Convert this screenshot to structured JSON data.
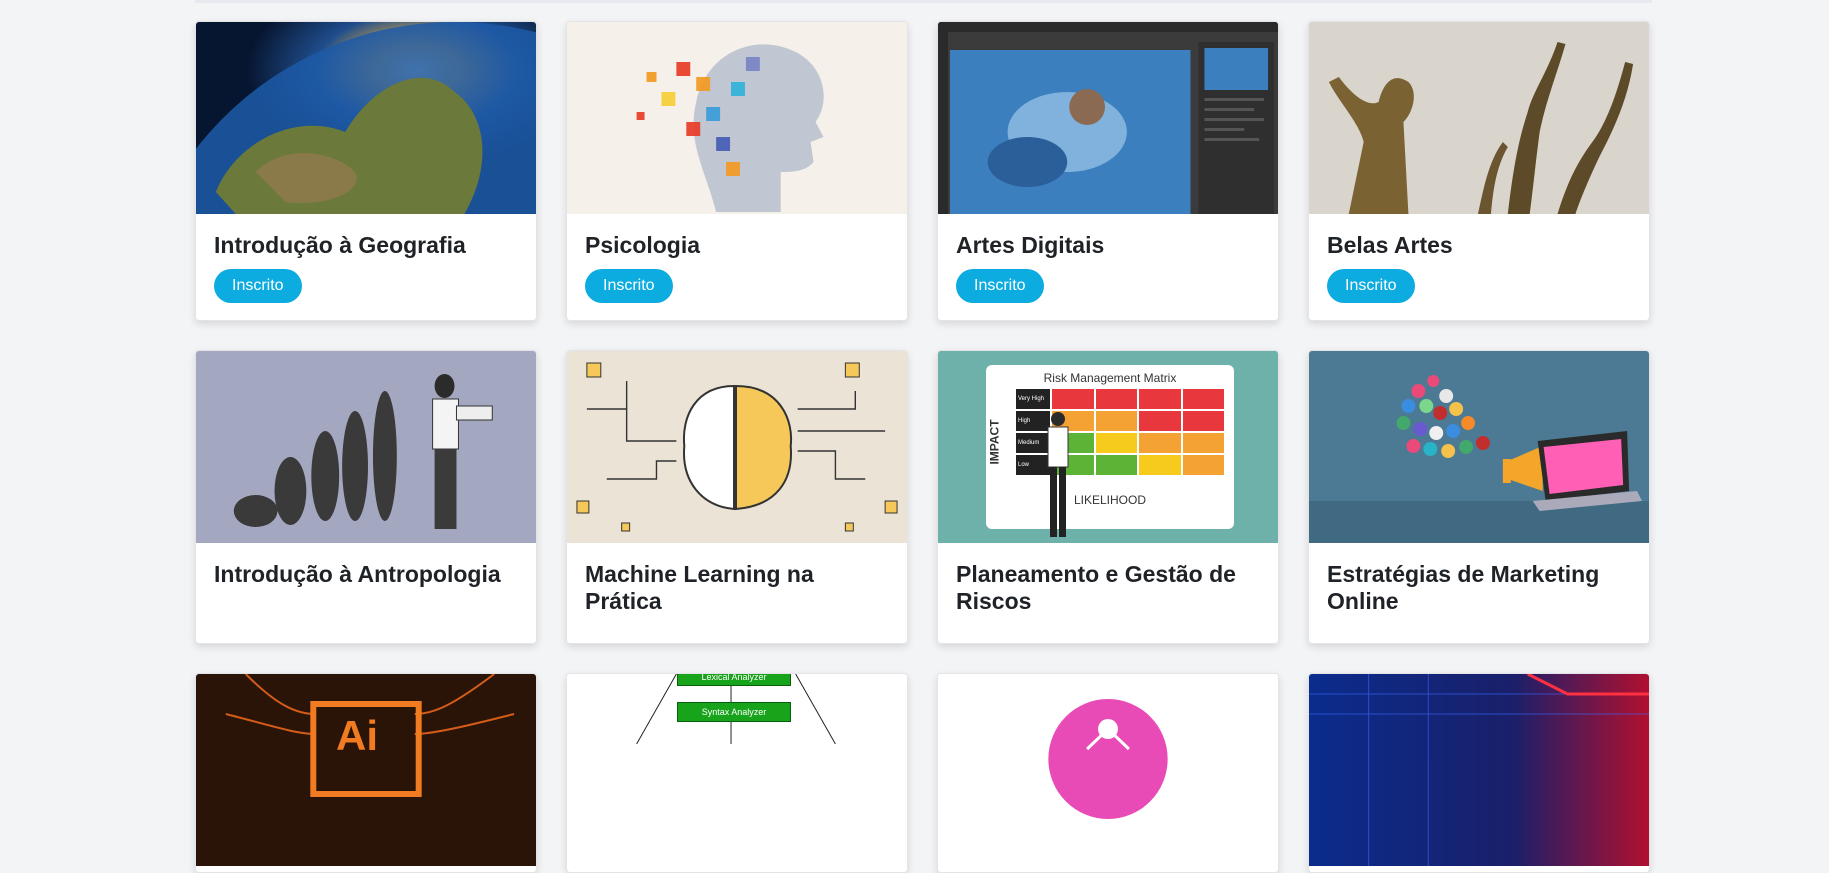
{
  "courses": [
    {
      "title": "Introdução à Geografia",
      "status": "Inscrito",
      "image": "earth-image"
    },
    {
      "title": "Psicologia",
      "status": "Inscrito",
      "image": "head-puzzle-image"
    },
    {
      "title": "Artes Digitais",
      "status": "Inscrito",
      "image": "photoshop-image"
    },
    {
      "title": "Belas Artes",
      "status": "Inscrito",
      "image": "sculpture-image"
    },
    {
      "title": "Introdução à Antropologia",
      "image": "evolution-image"
    },
    {
      "title": "Machine Learning na Prática",
      "image": "brain-gear-image"
    },
    {
      "title": "Planeamento e Gestão de Riscos",
      "image": "risk-matrix-image",
      "image_text": {
        "heading": "Risk Management Matrix",
        "y_axis": "IMPACT",
        "x_axis": "LIKELIHOOD",
        "rows": [
          "Very High",
          "High",
          "Medium",
          "Low"
        ]
      }
    },
    {
      "title": "Estratégias de Marketing Online",
      "image": "marketing-image"
    },
    {
      "title": "",
      "image": "illustrator-image",
      "image_text": {
        "logo": "Ai"
      }
    },
    {
      "title": "",
      "image": "compiler-diagram-image",
      "image_text": {
        "box1": "Lexical Analyzer",
        "box2": "Syntax Analyzer"
      }
    },
    {
      "title": "",
      "image": "pink-logo-image"
    },
    {
      "title": "",
      "image": "tech-blue-image"
    }
  ]
}
